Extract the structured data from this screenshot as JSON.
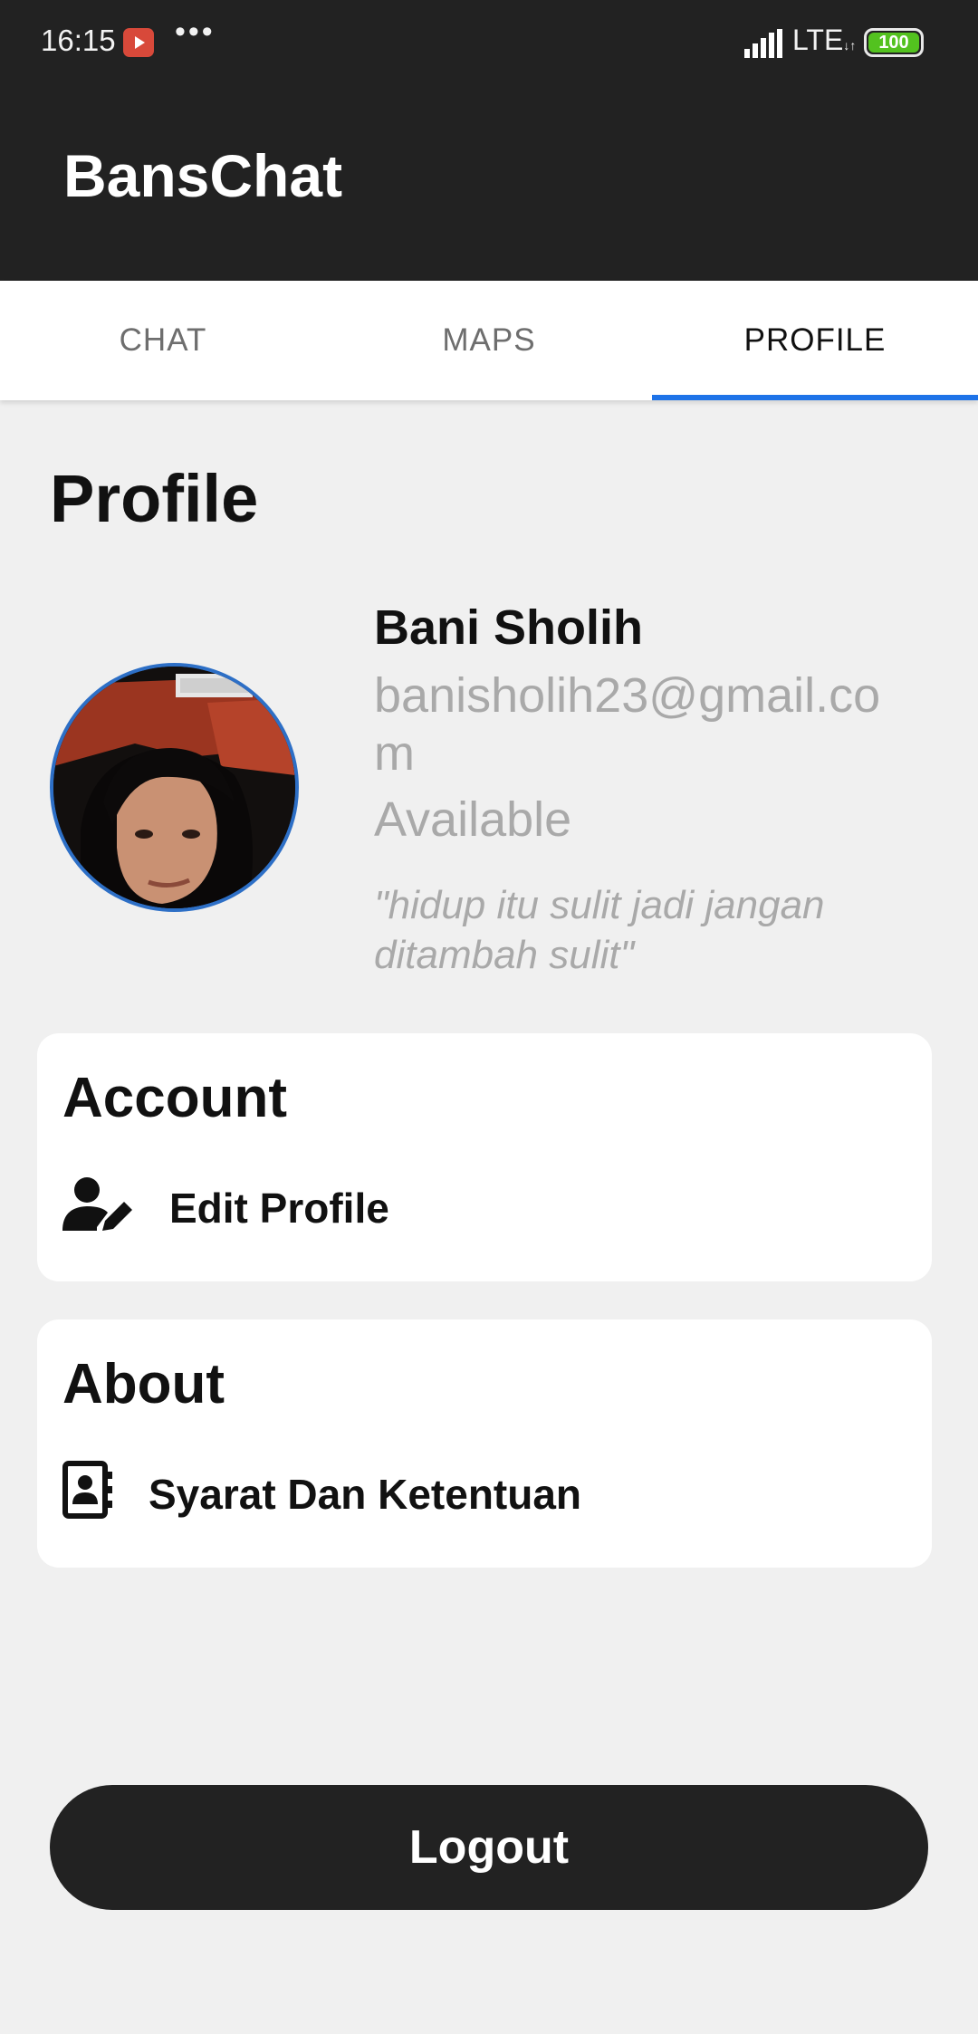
{
  "status_bar": {
    "time": "16:15",
    "network": "LTE",
    "battery": "100",
    "notification_icons": [
      "youtube-icon",
      "more-dots-icon"
    ]
  },
  "app": {
    "title": "BansChat"
  },
  "tabs": [
    {
      "label": "CHAT",
      "active": false
    },
    {
      "label": "MAPS",
      "active": false
    },
    {
      "label": "PROFILE",
      "active": true
    }
  ],
  "colors": {
    "bar": "#222222",
    "tab_indicator": "#1e73e8",
    "avatar_border": "#2d6fc6",
    "muted_text": "#a9a9a9",
    "background": "#f0f0f0"
  },
  "profile": {
    "heading": "Profile",
    "name": "Bani Sholih",
    "email": "banisholih23@gmail.com",
    "status": "Available",
    "quote": "\"hidup itu sulit jadi jangan ditambah sulit\""
  },
  "account_card": {
    "title": "Account",
    "item_label": "Edit Profile",
    "item_icon": "user-edit-icon"
  },
  "about_card": {
    "title": "About",
    "item_label": "Syarat Dan Ketentuan",
    "item_icon": "contact-book-icon"
  },
  "logout_label": "Logout"
}
